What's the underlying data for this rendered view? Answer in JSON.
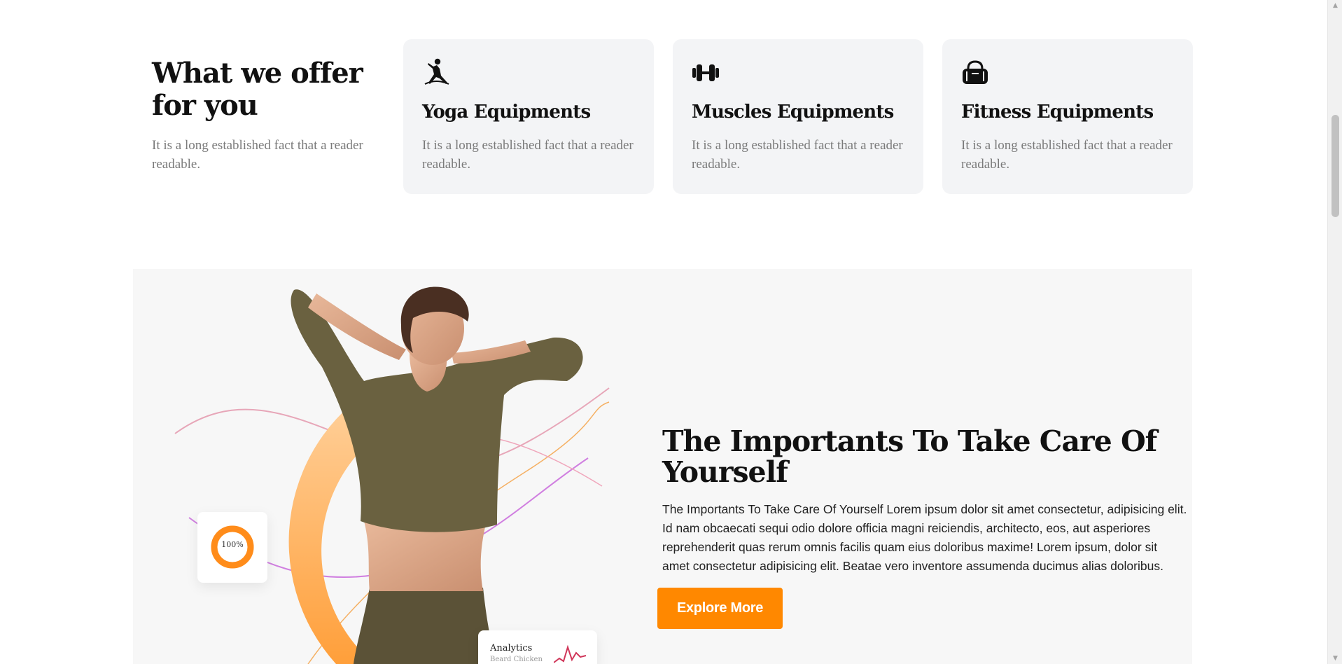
{
  "offer": {
    "title": "What we offer for you",
    "description": "It is a long established fact that a reader readable.",
    "cards": [
      {
        "icon": "yoga-pose-icon",
        "title": "Yoga Equipments",
        "description": "It is a long established fact that a reader readable."
      },
      {
        "icon": "dumbbell-icon",
        "title": "Muscles Equipments",
        "description": "It is a long established fact that a reader readable."
      },
      {
        "icon": "gym-bag-icon",
        "title": "Fitness Equipments",
        "description": "It is a long established fact that a reader readable."
      }
    ]
  },
  "care": {
    "title": "The Importants To Take Care Of Yourself",
    "body": "The Importants To Take Care Of Yourself Lorem ipsum dolor sit amet consectetur, adipisicing elit. Id nam obcaecati sequi odio dolore officia magni reiciendis, architecto, eos, aut asperiores reprehenderit quas rerum omnis facilis quam eius doloribus maxime! Lorem ipsum, dolor sit amet consectetur adipisicing elit. Beatae vero inventore assumenda ducimus alias doloribus.",
    "button_label": "Explore More",
    "stat_widget": {
      "value_label": "100%",
      "progress": 1.0
    },
    "analytics_widget": {
      "title": "Analytics",
      "subtitle": "Beard Chicken"
    }
  },
  "colors": {
    "accent": "#ff8800",
    "card_bg": "#f3f4f6",
    "section_bg": "#f7f7f7",
    "muted_text": "#7a7a7a"
  }
}
